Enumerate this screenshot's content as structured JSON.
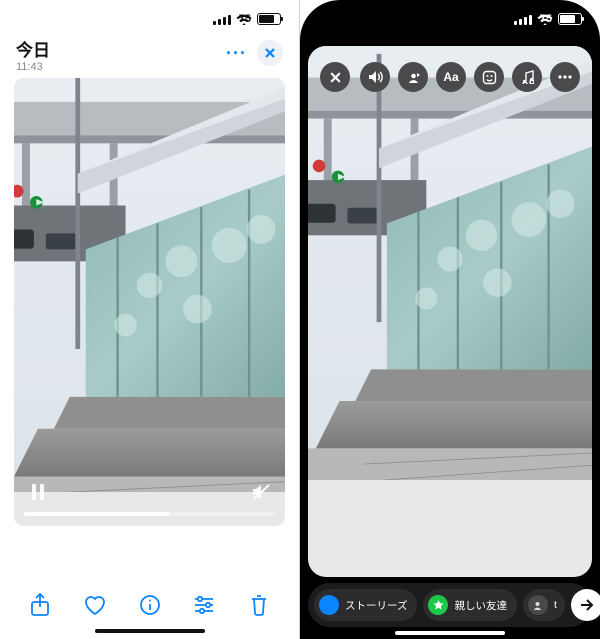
{
  "status": {
    "battery": "75"
  },
  "left": {
    "title": "今日",
    "time": "11:43",
    "more": "···",
    "play_state": "paused",
    "muted": true,
    "progress_pct": 58
  },
  "right": {
    "tools": {
      "text_label": "Aa"
    },
    "chips": {
      "story": "ストーリーズ",
      "close_friends": "親しい友達",
      "third": "t"
    }
  }
}
